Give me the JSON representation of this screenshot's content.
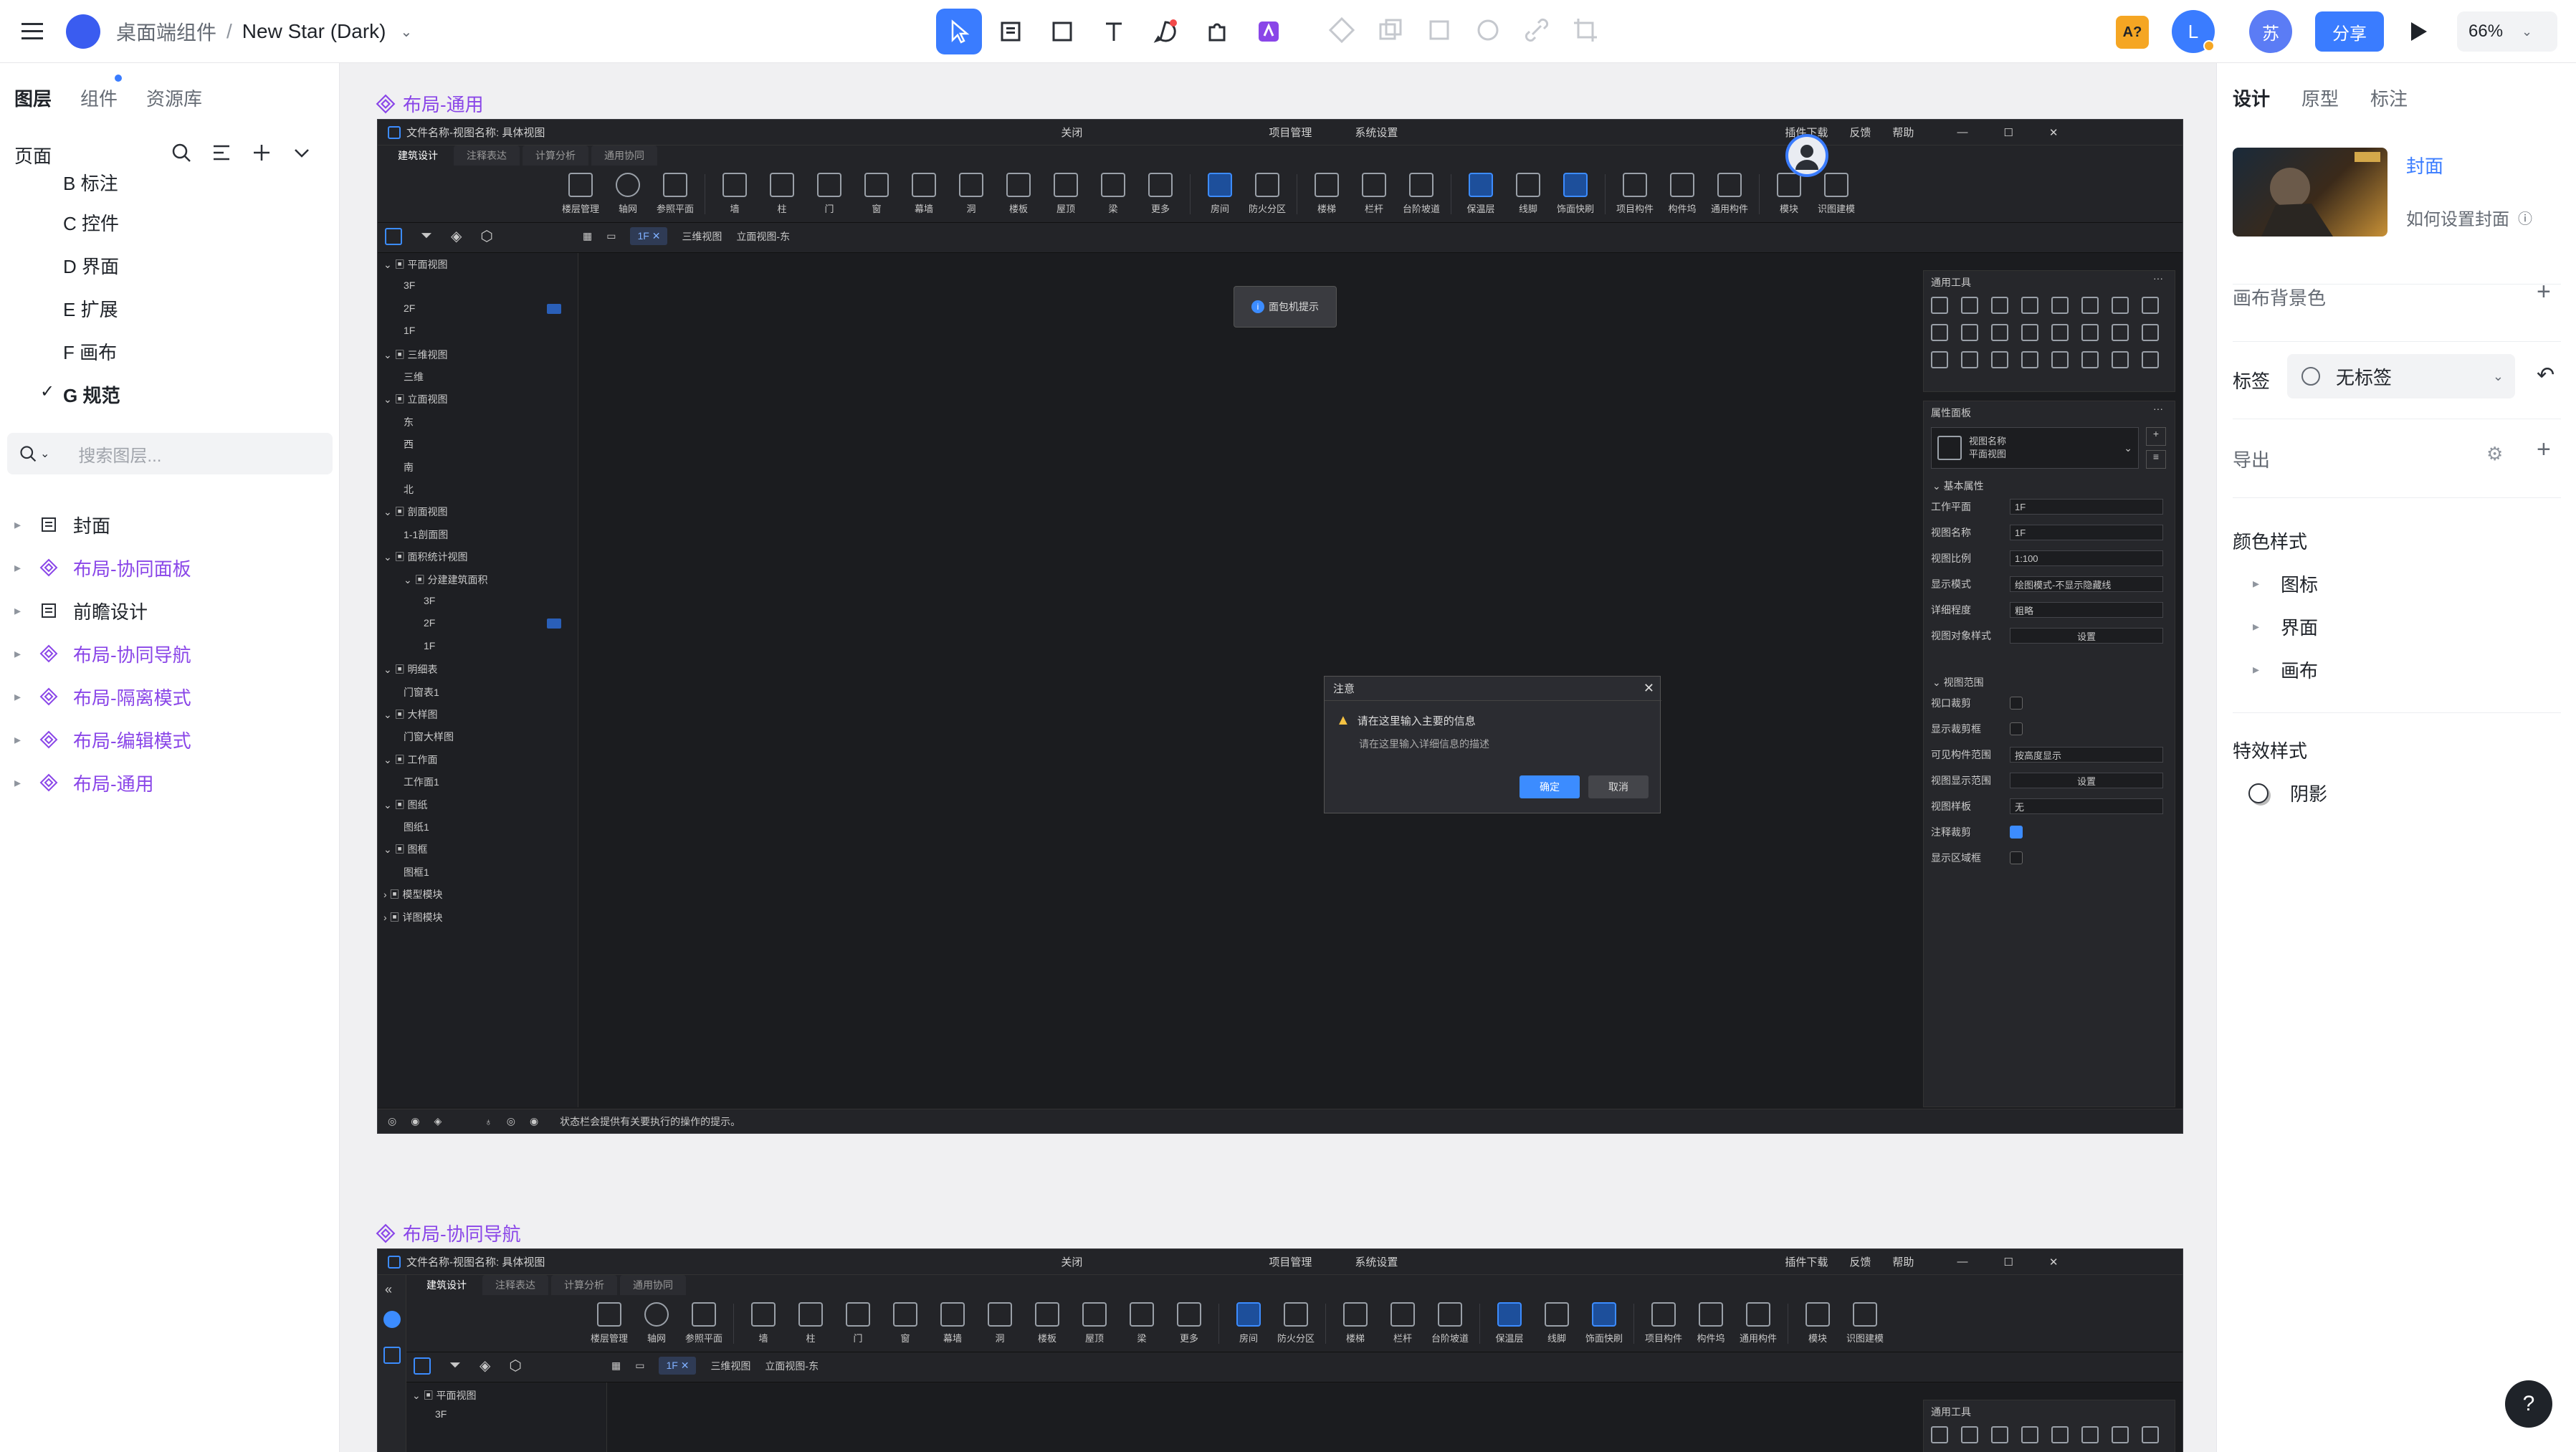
{
  "topbar": {
    "breadcrumb_parent": "桌面端组件",
    "separator": "/",
    "file_name": "New Star (Dark)",
    "badge_ai": "A?",
    "avatar_l": "L",
    "avatar_su": "苏",
    "share": "分享",
    "zoom": "66%"
  },
  "left": {
    "tabs": [
      "图层",
      "组件",
      "资源库"
    ],
    "pages_title": "页面",
    "pages": [
      "B 标注",
      "C 控件",
      "D 界面",
      "E 扩展",
      "F 画布",
      "G 规范"
    ],
    "search_placeholder": "搜索图层...",
    "layers": [
      {
        "label": "封面",
        "type": "frame"
      },
      {
        "label": "布局-协同面板",
        "type": "component"
      },
      {
        "label": "前瞻设计",
        "type": "frame"
      },
      {
        "label": "布局-协同导航",
        "type": "component"
      },
      {
        "label": "布局-隔离模式",
        "type": "component"
      },
      {
        "label": "布局-编辑模式",
        "type": "component"
      },
      {
        "label": "布局-通用",
        "type": "component"
      }
    ]
  },
  "right": {
    "tabs": [
      "设计",
      "原型",
      "标注"
    ],
    "cover_title": "封面",
    "cover_hint": "如何设置封面",
    "canvas_bg": "画布背景色",
    "tag_label": "标签",
    "tag_value": "无标签",
    "export_label": "导出",
    "color_styles": "颜色样式",
    "color_items": [
      "图标",
      "界面",
      "画布"
    ],
    "effect_styles": "特效样式",
    "effect_items": [
      "阴影"
    ],
    "help": "?"
  },
  "canvas": {
    "frame1_label": "布局-通用",
    "frame2_label": "布局-协同导航"
  },
  "app": {
    "title": "文件名称-视图名称: 具体视图",
    "menu": [
      "关闭",
      "项目管理",
      "系统设置"
    ],
    "right_menu": [
      "插件下载",
      "反馈",
      "帮助"
    ],
    "tabs": [
      "建筑设计",
      "注释表达",
      "计算分析",
      "通用协同"
    ],
    "ribbon": [
      "楼层管理",
      "轴网",
      "参照平面",
      "墙",
      "柱",
      "门",
      "窗",
      "幕墙",
      "洞",
      "楼板",
      "屋顶",
      "梁",
      "更多",
      "房间",
      "防火分区",
      "楼梯",
      "栏杆",
      "台阶坡道",
      "保温层",
      "线脚",
      "饰面快刷",
      "项目构件",
      "构件坞",
      "通用构件",
      "模块",
      "识图建模"
    ],
    "doc_tabs": [
      "1F",
      "三维视图",
      "立面视图-东"
    ],
    "tree": [
      "平面视图",
      "3F",
      "2F",
      "1F",
      "三维视图",
      "三维",
      "立面视图",
      "东",
      "西",
      "南",
      "北",
      "剖面视图",
      "1-1剖面图",
      "面积统计视图",
      "分建建筑面积",
      "3F",
      "2F",
      "1F",
      "明细表",
      "门窗表1",
      "大样图",
      "门窗大样图",
      "工作面",
      "工作面1",
      "图纸",
      "图纸1",
      "图框",
      "图框1",
      "模型模块",
      "详图模块"
    ],
    "hint_popup": "面包机提示",
    "dialog": {
      "title": "注意",
      "main": "请在这里输入主要的信息",
      "sub": "请在这里输入详细信息的描述",
      "ok": "确定",
      "cancel": "取消"
    },
    "tools_title": "通用工具",
    "props_title": "属性面板",
    "view_name_label": "视图名称",
    "view_name_value": "平面视图",
    "basic_props": "基本属性",
    "props": [
      {
        "k": "工作平面",
        "v": "1F"
      },
      {
        "k": "视图名称",
        "v": "1F"
      },
      {
        "k": "视图比例",
        "v": "1:100"
      },
      {
        "k": "显示模式",
        "v": "绘图模式-不显示隐藏线"
      },
      {
        "k": "详细程度",
        "v": "粗略"
      },
      {
        "k": "视图对象样式",
        "v": "设置"
      }
    ],
    "view_range": "视图范围",
    "range_props": [
      {
        "k": "视口裁剪",
        "v": ""
      },
      {
        "k": "显示裁剪框",
        "v": ""
      },
      {
        "k": "可见构件范围",
        "v": "按高度显示"
      },
      {
        "k": "视图显示范围",
        "v": "设置"
      },
      {
        "k": "视图样板",
        "v": "无"
      },
      {
        "k": "注释裁剪",
        "v": ""
      },
      {
        "k": "显示区域框",
        "v": ""
      }
    ],
    "status": "状态栏会提供有关要执行的操作的提示。"
  }
}
